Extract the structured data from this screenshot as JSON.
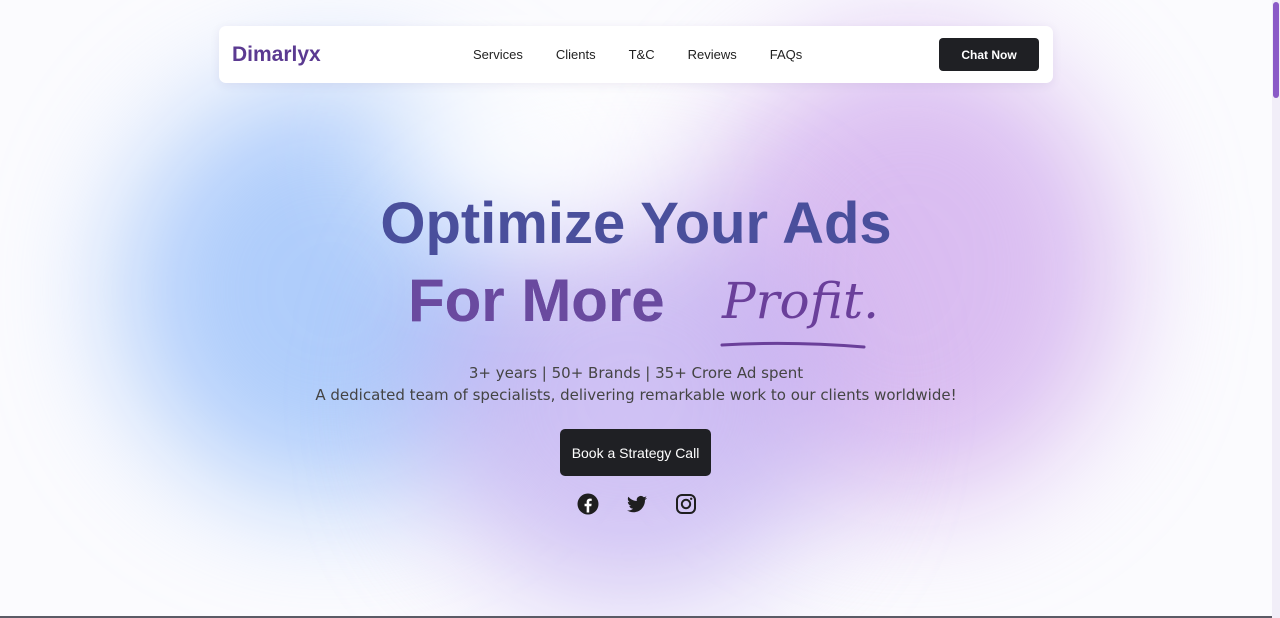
{
  "nav": {
    "brand": "Dimarlyx",
    "links": [
      {
        "label": "Services"
      },
      {
        "label": "Clients"
      },
      {
        "label": "T&C"
      },
      {
        "label": "Reviews"
      },
      {
        "label": "FAQs"
      }
    ],
    "cta_label": "Chat Now"
  },
  "hero": {
    "headline_line1": "Optimize Your Ads",
    "headline_line2": "For More",
    "headline_script": "Profit.",
    "stats": "3+ years | 50+ Brands | 35+ Crore Ad spent",
    "tagline": "A dedicated team of specialists, delivering remarkable work to our clients worldwide!",
    "cta_label": "Book a Strategy Call"
  },
  "socials": [
    {
      "icon": "facebook-icon"
    },
    {
      "icon": "twitter-icon"
    },
    {
      "icon": "instagram-icon"
    }
  ],
  "colors": {
    "brand": "#5b3a91",
    "headline_blue": "#4a4f9c",
    "headline_purple": "#6a4a9a",
    "dark_button": "#1f2024",
    "scroll_thumb": "#8a5ac7"
  }
}
